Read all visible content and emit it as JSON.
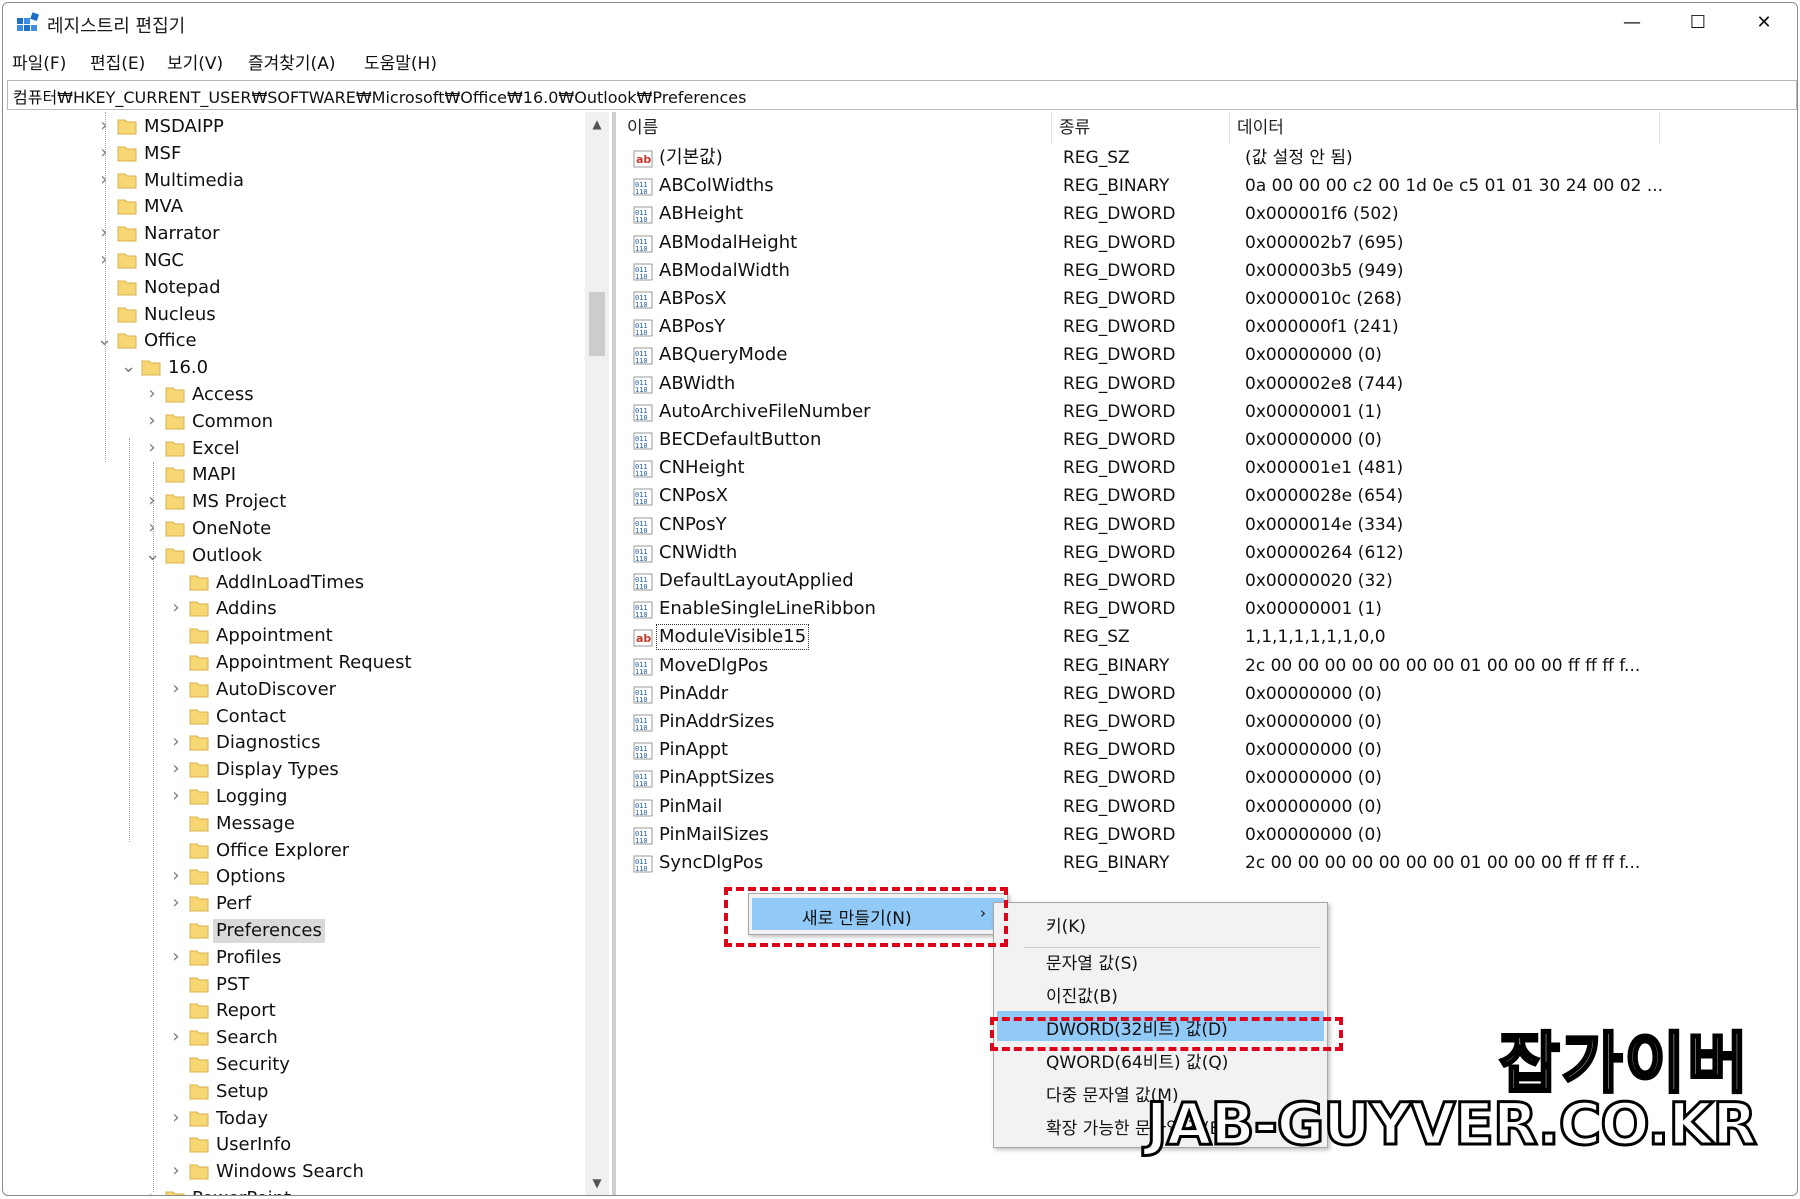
{
  "window": {
    "title": "레지스트리 편집기",
    "minimize": "—",
    "maximize": "☐",
    "close": "✕"
  },
  "menu": [
    "파일(F)",
    "편집(E)",
    "보기(V)",
    "즐겨찾기(A)",
    "도움말(H)"
  ],
  "address": "컴퓨터₩HKEY_CURRENT_USER₩SOFTWARE₩Microsoft₩Office₩16.0₩Outlook₩Preferences",
  "tree": [
    {
      "label": "MSDAIPP",
      "level": 0,
      "expander": "collapsed"
    },
    {
      "label": "MSF",
      "level": 0,
      "expander": "collapsed"
    },
    {
      "label": "Multimedia",
      "level": 0,
      "expander": "collapsed"
    },
    {
      "label": "MVA",
      "level": 0,
      "expander": "none"
    },
    {
      "label": "Narrator",
      "level": 0,
      "expander": "collapsed"
    },
    {
      "label": "NGC",
      "level": 0,
      "expander": "collapsed"
    },
    {
      "label": "Notepad",
      "level": 0,
      "expander": "none"
    },
    {
      "label": "Nucleus",
      "level": 0,
      "expander": "none"
    },
    {
      "label": "Office",
      "level": 0,
      "expander": "expanded"
    },
    {
      "label": "16.0",
      "level": 1,
      "expander": "expanded"
    },
    {
      "label": "Access",
      "level": 2,
      "expander": "collapsed"
    },
    {
      "label": "Common",
      "level": 2,
      "expander": "collapsed"
    },
    {
      "label": "Excel",
      "level": 2,
      "expander": "collapsed"
    },
    {
      "label": "MAPI",
      "level": 2,
      "expander": "none"
    },
    {
      "label": "MS Project",
      "level": 2,
      "expander": "collapsed"
    },
    {
      "label": "OneNote",
      "level": 2,
      "expander": "collapsed"
    },
    {
      "label": "Outlook",
      "level": 2,
      "expander": "expanded"
    },
    {
      "label": "AddInLoadTimes",
      "level": 3,
      "expander": "none"
    },
    {
      "label": "Addins",
      "level": 3,
      "expander": "collapsed"
    },
    {
      "label": "Appointment",
      "level": 3,
      "expander": "none"
    },
    {
      "label": "Appointment Request",
      "level": 3,
      "expander": "none"
    },
    {
      "label": "AutoDiscover",
      "level": 3,
      "expander": "collapsed"
    },
    {
      "label": "Contact",
      "level": 3,
      "expander": "none"
    },
    {
      "label": "Diagnostics",
      "level": 3,
      "expander": "collapsed"
    },
    {
      "label": "Display Types",
      "level": 3,
      "expander": "collapsed"
    },
    {
      "label": "Logging",
      "level": 3,
      "expander": "collapsed"
    },
    {
      "label": "Message",
      "level": 3,
      "expander": "none"
    },
    {
      "label": "Office Explorer",
      "level": 3,
      "expander": "none"
    },
    {
      "label": "Options",
      "level": 3,
      "expander": "collapsed"
    },
    {
      "label": "Perf",
      "level": 3,
      "expander": "collapsed"
    },
    {
      "label": "Preferences",
      "level": 3,
      "expander": "none",
      "selected": true
    },
    {
      "label": "Profiles",
      "level": 3,
      "expander": "collapsed"
    },
    {
      "label": "PST",
      "level": 3,
      "expander": "none"
    },
    {
      "label": "Report",
      "level": 3,
      "expander": "none"
    },
    {
      "label": "Search",
      "level": 3,
      "expander": "collapsed"
    },
    {
      "label": "Security",
      "level": 3,
      "expander": "none"
    },
    {
      "label": "Setup",
      "level": 3,
      "expander": "none"
    },
    {
      "label": "Today",
      "level": 3,
      "expander": "collapsed"
    },
    {
      "label": "UserInfo",
      "level": 3,
      "expander": "none"
    },
    {
      "label": "Windows Search",
      "level": 3,
      "expander": "collapsed"
    },
    {
      "label": "PowerPoint",
      "level": 2,
      "expander": "collapsed"
    }
  ],
  "columns": {
    "name": "이름",
    "type": "종류",
    "data": "데이터"
  },
  "values": [
    {
      "name": "(기본값)",
      "type": "REG_SZ",
      "data": "(값 설정 안 됨)",
      "kind": "sz"
    },
    {
      "name": "ABColWidths",
      "type": "REG_BINARY",
      "data": "0a 00 00 00 c2 00 1d 0e c5 01 01 30 24 00 02 ...",
      "kind": "bin"
    },
    {
      "name": "ABHeight",
      "type": "REG_DWORD",
      "data": "0x000001f6 (502)",
      "kind": "bin"
    },
    {
      "name": "ABModalHeight",
      "type": "REG_DWORD",
      "data": "0x000002b7 (695)",
      "kind": "bin"
    },
    {
      "name": "ABModalWidth",
      "type": "REG_DWORD",
      "data": "0x000003b5 (949)",
      "kind": "bin"
    },
    {
      "name": "ABPosX",
      "type": "REG_DWORD",
      "data": "0x0000010c (268)",
      "kind": "bin"
    },
    {
      "name": "ABPosY",
      "type": "REG_DWORD",
      "data": "0x000000f1 (241)",
      "kind": "bin"
    },
    {
      "name": "ABQueryMode",
      "type": "REG_DWORD",
      "data": "0x00000000 (0)",
      "kind": "bin"
    },
    {
      "name": "ABWidth",
      "type": "REG_DWORD",
      "data": "0x000002e8 (744)",
      "kind": "bin"
    },
    {
      "name": "AutoArchiveFileNumber",
      "type": "REG_DWORD",
      "data": "0x00000001 (1)",
      "kind": "bin"
    },
    {
      "name": "BECDefaultButton",
      "type": "REG_DWORD",
      "data": "0x00000000 (0)",
      "kind": "bin"
    },
    {
      "name": "CNHeight",
      "type": "REG_DWORD",
      "data": "0x000001e1 (481)",
      "kind": "bin"
    },
    {
      "name": "CNPosX",
      "type": "REG_DWORD",
      "data": "0x0000028e (654)",
      "kind": "bin"
    },
    {
      "name": "CNPosY",
      "type": "REG_DWORD",
      "data": "0x0000014e (334)",
      "kind": "bin"
    },
    {
      "name": "CNWidth",
      "type": "REG_DWORD",
      "data": "0x00000264 (612)",
      "kind": "bin"
    },
    {
      "name": "DefaultLayoutApplied",
      "type": "REG_DWORD",
      "data": "0x00000020 (32)",
      "kind": "bin"
    },
    {
      "name": "EnableSingleLineRibbon",
      "type": "REG_DWORD",
      "data": "0x00000001 (1)",
      "kind": "bin"
    },
    {
      "name": "ModuleVisible15",
      "type": "REG_SZ",
      "data": "1,1,1,1,1,1,1,0,0",
      "kind": "sz",
      "focused": true
    },
    {
      "name": "MoveDlgPos",
      "type": "REG_BINARY",
      "data": "2c 00 00 00 00 00 00 00 01 00 00 00 ff ff ff f...",
      "kind": "bin"
    },
    {
      "name": "PinAddr",
      "type": "REG_DWORD",
      "data": "0x00000000 (0)",
      "kind": "bin"
    },
    {
      "name": "PinAddrSizes",
      "type": "REG_DWORD",
      "data": "0x00000000 (0)",
      "kind": "bin"
    },
    {
      "name": "PinAppt",
      "type": "REG_DWORD",
      "data": "0x00000000 (0)",
      "kind": "bin"
    },
    {
      "name": "PinApptSizes",
      "type": "REG_DWORD",
      "data": "0x00000000 (0)",
      "kind": "bin"
    },
    {
      "name": "PinMail",
      "type": "REG_DWORD",
      "data": "0x00000000 (0)",
      "kind": "bin"
    },
    {
      "name": "PinMailSizes",
      "type": "REG_DWORD",
      "data": "0x00000000 (0)",
      "kind": "bin"
    },
    {
      "name": "SyncDlgPos",
      "type": "REG_BINARY",
      "data": "2c 00 00 00 00 00 00 00 01 00 00 00 ff ff ff f...",
      "kind": "bin"
    }
  ],
  "context_menu": {
    "label": "새로 만들기(N)",
    "arrow": "›"
  },
  "submenu": [
    {
      "label": "키(K)"
    },
    {
      "label": "문자열 값(S)"
    },
    {
      "label": "이진값(B)"
    },
    {
      "label": "DWORD(32비트) 값(D)",
      "highlighted": true
    },
    {
      "label": "QWORD(64비트) 값(Q)"
    },
    {
      "label": "다중 문자열 값(M)"
    },
    {
      "label": "확장 가능한 문자열 값(E)"
    }
  ],
  "watermark": {
    "line1": "잡가이버",
    "line2": "JAB-GUYVER.CO.KR"
  },
  "colors": {
    "highlight": "#91c9f7",
    "annotation": "#e0001a",
    "folder": "#f7d674",
    "selected_tree": "#d9d9d9"
  }
}
